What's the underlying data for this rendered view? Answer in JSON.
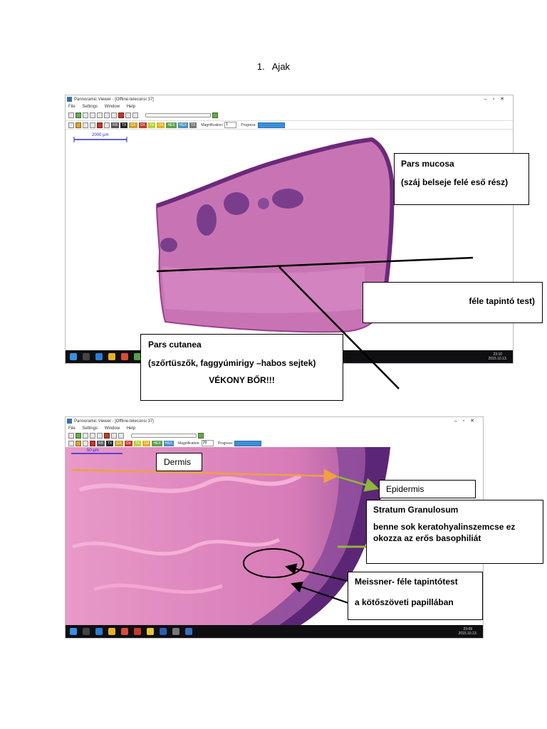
{
  "heading": {
    "number": "1.",
    "text": "Ajak"
  },
  "viewer": {
    "title1": "Pannoramic Viewer - [Offline-teleconsi 37]",
    "title2": "Pannoramic Viewer - [Offline-teleconsi 37]",
    "menu": [
      "File",
      "Settings",
      "Window",
      "Help"
    ],
    "channels": [
      "RB",
      "TX",
      "GX",
      "OX",
      "TX",
      "OX",
      "HEX",
      "HEX",
      "TX"
    ],
    "magnification_label": "Magnification:",
    "magnification1": "1",
    "magnification2": "20",
    "progress_label": "Progress:",
    "progress": 1.0,
    "scale_bar1": "2000 µm",
    "scale_bar2": "50 µm",
    "clock1": {
      "time": "23:10",
      "date": "2015.10.13."
    },
    "clock2": {
      "time": "23:09",
      "date": "2015.10.13."
    }
  },
  "annotations1": {
    "pars_mucosa": {
      "title": "Pars mucosa",
      "desc": "(száj belseje felé eső rész)"
    },
    "tapinto": {
      "text": "féle tapintó test)"
    },
    "pars_cutanea": {
      "title": "Pars cutanea",
      "desc": "(szőrtüszők, faggyúmirigy –habos sejtek)",
      "note": "VÉKONY BŐR!!!"
    }
  },
  "annotations2": {
    "dermis": "Dermis",
    "epidermis": "Epidermis",
    "stratum": {
      "title": "Stratum Granulosum",
      "desc": "benne sok keratohyalinszemcse ez okozza az erős basophiliát"
    },
    "meissner": {
      "title": "Meissner- féle tapintótest",
      "desc": "a kötőszöveti papillában"
    }
  },
  "colors": {
    "tissue_pink": "#c874b4",
    "tissue_purple": "#7a3d8c",
    "arrow_orange": "#f0a040",
    "arrow_green": "#8db83a",
    "progress_blue": "#3b8fd9",
    "taskbar": "#0f0f12"
  }
}
